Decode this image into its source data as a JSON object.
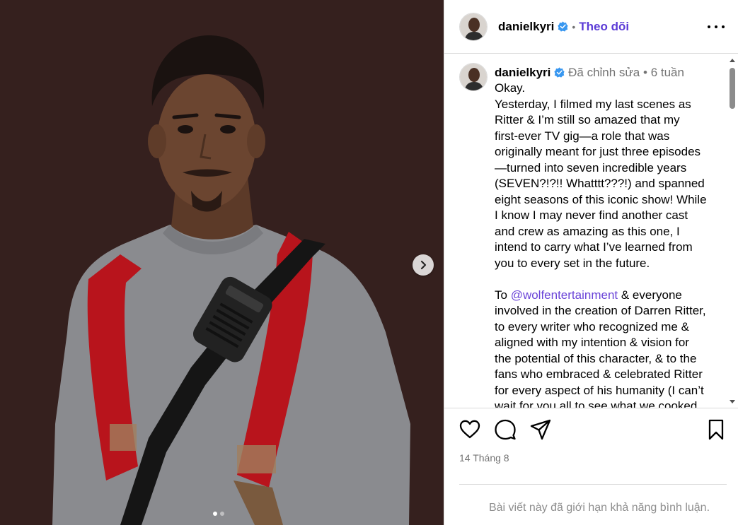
{
  "post": {
    "username": "danielkyri",
    "follow_label": "Theo dõi",
    "separator": "•",
    "edited_label": "Đã chỉnh sửa",
    "meta_separator": "•",
    "age": "6 tuần",
    "caption_lines": [
      "Okay.",
      "Yesterday, I filmed my last scenes as",
      "Ritter & I’m still so amazed that my",
      "first-ever TV gig—a role that was",
      "originally meant for just three episodes",
      "—turned into seven incredible years",
      "(SEVEN?!?!! Whatttt???!) and spanned",
      "eight seasons of this iconic show! While",
      "I know I may never find another cast",
      "and crew as amazing as this one, I",
      "intend to carry what I’ve learned from",
      "you to every set in the future."
    ],
    "para2_prefix": "To ",
    "mention": "@wolfentertainment",
    "para2_first_rest": " & everyone",
    "para2_lines": [
      "involved in the creation of Darren Ritter,",
      "to every writer who recognized me &",
      "aligned with my intention & vision for",
      "the potential of this character, & to the",
      "fans who embraced & celebrated Ritter",
      "for every aspect of his humanity (I can’t",
      "wait for you all to see what we cooked"
    ],
    "date": "14 Tháng 8",
    "comments_limited": "Bài viết này đã giới hạn khả năng bình luận.",
    "carousel": {
      "total": 2,
      "active": 1
    }
  },
  "icons": {
    "verified": "verified-badge-icon",
    "more": "more-options-icon",
    "like": "heart-icon",
    "comment": "comment-icon",
    "share": "send-icon",
    "save": "bookmark-icon",
    "next": "chevron-right-icon"
  },
  "colors": {
    "follow": "#5b3bd6",
    "mention": "#6a44d8",
    "verified": "#3897f0",
    "media_bg": "#35201e"
  }
}
